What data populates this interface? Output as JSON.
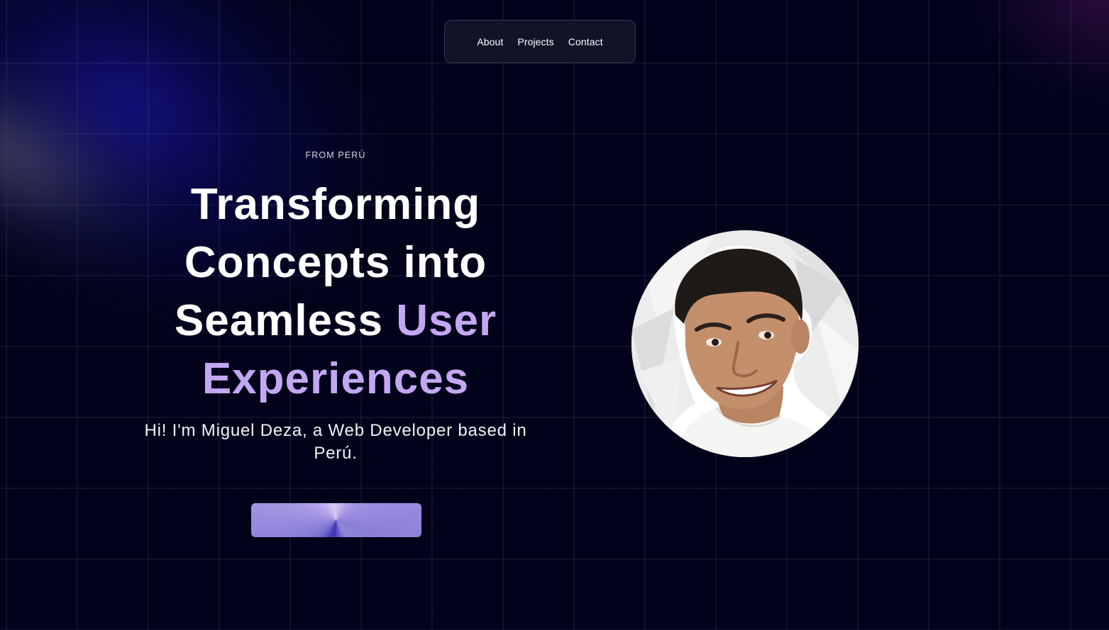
{
  "nav": {
    "items": [
      {
        "label": "About"
      },
      {
        "label": "Projects"
      },
      {
        "label": "Contact"
      }
    ]
  },
  "hero": {
    "eyebrow": "FROM PERÚ",
    "headline_lines": [
      "Transforming",
      "Concepts into",
      "Seamless "
    ],
    "headline_accent_1": "User",
    "headline_accent_2": "Experiences",
    "intro": "Hi! I'm Miguel Deza, a Web Developer based in Perú.",
    "cta_label": ""
  },
  "profile": {
    "image_alt": "Miguel Deza portrait"
  },
  "colors": {
    "background": "#02031a",
    "accent": "#c4a7f2",
    "text": "#ffffff"
  }
}
